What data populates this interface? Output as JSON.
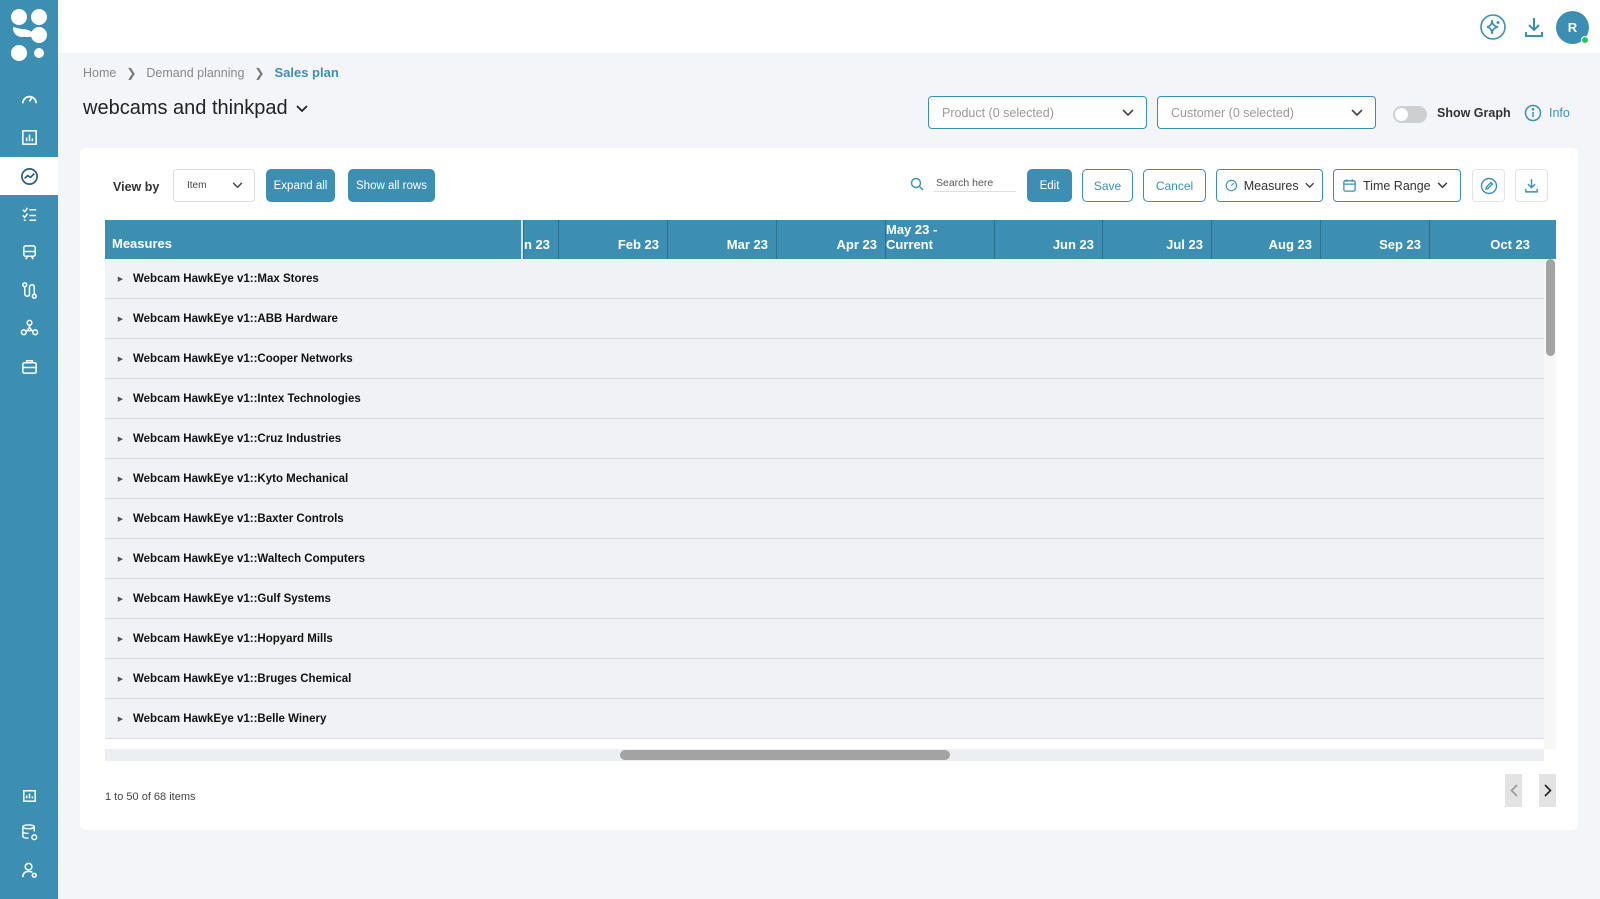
{
  "nav": {
    "items": [
      {
        "name": "dashboard-icon",
        "active": false
      },
      {
        "name": "reports-icon",
        "active": false
      },
      {
        "name": "demand-planning-icon",
        "active": true
      },
      {
        "name": "tasks-icon",
        "active": false
      },
      {
        "name": "supply-icon",
        "active": false
      },
      {
        "name": "workflow-icon",
        "active": false
      },
      {
        "name": "network-icon",
        "active": false
      },
      {
        "name": "portfolio-icon",
        "active": false
      }
    ],
    "bottom_items": [
      {
        "name": "analytics-icon"
      },
      {
        "name": "data-settings-icon"
      },
      {
        "name": "user-settings-icon"
      }
    ]
  },
  "topbar": {
    "avatar_initial": "R"
  },
  "breadcrumb": {
    "home": "Home",
    "section": "Demand planning",
    "current": "Sales plan"
  },
  "page": {
    "title": "webcams and thinkpad"
  },
  "filters": {
    "product": "Product (0 selected)",
    "customer": "Customer (0 selected)",
    "show_graph": "Show Graph",
    "show_graph_on": false,
    "info": "Info"
  },
  "toolbar": {
    "view_by_label": "View by",
    "view_by_value": "Item",
    "expand_all": "Expand all",
    "show_all_rows": "Show all rows",
    "search_placeholder": "Search here",
    "edit": "Edit",
    "save": "Save",
    "cancel": "Cancel",
    "measures": "Measures",
    "time_range": "Time Range"
  },
  "grid": {
    "measures_header": "Measures",
    "columns": [
      "n 23",
      "Feb 23",
      "Mar 23",
      "Apr 23",
      "May 23 - Current",
      "Jun 23",
      "Jul 23",
      "Aug 23",
      "Sep 23",
      "Oct 23"
    ],
    "rows": [
      "Webcam HawkEye v1::Max Stores",
      "Webcam HawkEye v1::ABB Hardware",
      "Webcam HawkEye v1::Cooper Networks",
      "Webcam HawkEye v1::Intex Technologies",
      "Webcam HawkEye v1::Cruz Industries",
      "Webcam HawkEye v1::Kyto Mechanical",
      "Webcam HawkEye v1::Baxter Controls",
      "Webcam HawkEye v1::Waltech Computers",
      "Webcam HawkEye v1::Gulf Systems",
      "Webcam HawkEye v1::Hopyard Mills",
      "Webcam HawkEye v1::Bruges Chemical",
      "Webcam HawkEye v1::Belle Winery"
    ]
  },
  "pagination": {
    "summary": "1 to 50 of 68 items"
  },
  "colors": {
    "accent": "#3c8fb3",
    "row_bg": "#f0f2f5",
    "page_bg": "#f4f5f8"
  }
}
